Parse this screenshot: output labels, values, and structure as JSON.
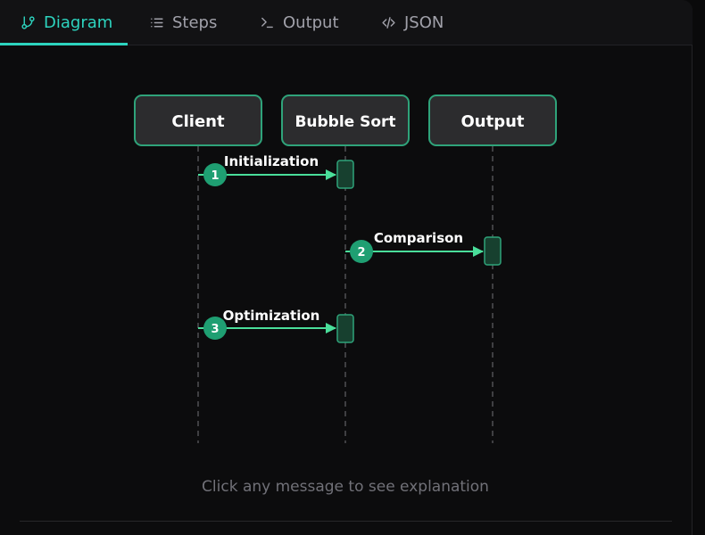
{
  "tabs": [
    {
      "label": "Diagram",
      "icon": "git-branch-icon",
      "active": true
    },
    {
      "label": "Steps",
      "icon": "list-icon",
      "active": false
    },
    {
      "label": "Output",
      "icon": "terminal-icon",
      "active": false
    },
    {
      "label": "JSON",
      "icon": "code-icon",
      "active": false
    }
  ],
  "participants": [
    {
      "label": "Client"
    },
    {
      "label": "Bubble Sort"
    },
    {
      "label": "Output"
    }
  ],
  "messages": [
    {
      "step": "1",
      "label": "Initialization",
      "from": "Client",
      "to": "Bubble Sort"
    },
    {
      "step": "2",
      "label": "Comparison",
      "from": "Bubble Sort",
      "to": "Output"
    },
    {
      "step": "3",
      "label": "Optimization",
      "from": "Client",
      "to": "Bubble Sort"
    }
  ],
  "hint": "Click any message to see explanation",
  "colors": {
    "accent": "#2dd4bf",
    "node_border": "#2fa37a",
    "node_fill": "#2c2c2e",
    "badge": "#1f9f72",
    "arrow": "#4ade9a",
    "activation_fill": "#17402f"
  }
}
